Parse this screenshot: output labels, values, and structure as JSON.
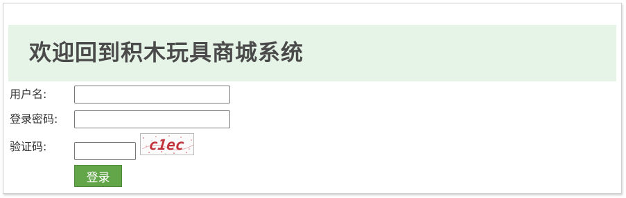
{
  "header": {
    "title": "欢迎回到积木玩具商城系统"
  },
  "form": {
    "username_label": "用户名:",
    "username_value": "",
    "password_label": "登录密码:",
    "password_value": "",
    "captcha_label": "验证码:",
    "captcha_value": "",
    "captcha_image_text": "c1ec",
    "login_label": "登录"
  },
  "colors": {
    "banner_bg": "#e6f3e7",
    "title_text": "#4a4a4a",
    "button_bg": "#63a64a",
    "captcha_text": "#c0313a"
  }
}
